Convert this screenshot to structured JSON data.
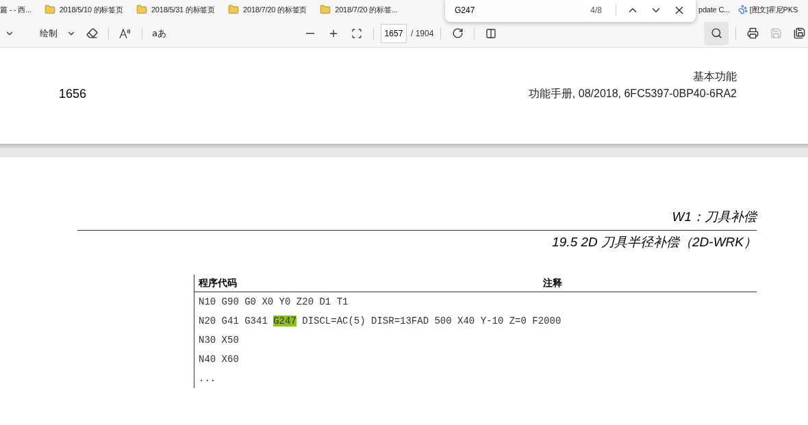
{
  "bookmarks": [
    {
      "label": "篇 - - 西...",
      "kind": "plain"
    },
    {
      "label": "2018/5/10 的标签页",
      "kind": "folder"
    },
    {
      "label": "2018/5/31 的标签页",
      "kind": "folder"
    },
    {
      "label": "2018/7/20 的标签页",
      "kind": "folder"
    },
    {
      "label": "2018/7/20 的标签...",
      "kind": "folder"
    },
    {
      "label": "pdate C...",
      "kind": "plain"
    },
    {
      "label": "[图文]霍尼PKS",
      "kind": "paw"
    }
  ],
  "find_bar": {
    "value": "G247",
    "count": "4/8"
  },
  "toolbar": {
    "draw_label": "绘制",
    "text_options": "aあ",
    "page_value": "1657",
    "page_total": "/ 1904",
    "search_active": true,
    "save_disabled": true
  },
  "page_top": {
    "page_number": "1656",
    "header_lines": [
      "基本功能",
      "功能手册, 08/2018, 6FC5397-0BP40-6RA2"
    ]
  },
  "page": {
    "chapter": "W1：刀具补偿",
    "section": "19.5 2D 刀具半径补偿（2D-WRK）",
    "table": {
      "columns": [
        "程序代码",
        "注释"
      ],
      "rows": [
        {
          "code": [
            {
              "text": "N10 G90 G0 X0 Y0 Z20 D1 T1",
              "highlighted": false
            }
          ]
        },
        {
          "code": [
            {
              "text": "N20 G41 G341 ",
              "highlighted": false
            },
            {
              "text": "G247",
              "highlighted": true
            },
            {
              "text": " DISCL=AC(5) DISR=13FAD 500 X40 Y-10 Z=0 F2000",
              "highlighted": false
            }
          ]
        },
        {
          "code": [
            {
              "text": "N30 X50",
              "highlighted": false
            }
          ]
        },
        {
          "code": [
            {
              "text": "N40 X60",
              "highlighted": false
            }
          ]
        },
        {
          "code": [
            {
              "text": "...",
              "highlighted": false
            }
          ]
        }
      ]
    }
  }
}
